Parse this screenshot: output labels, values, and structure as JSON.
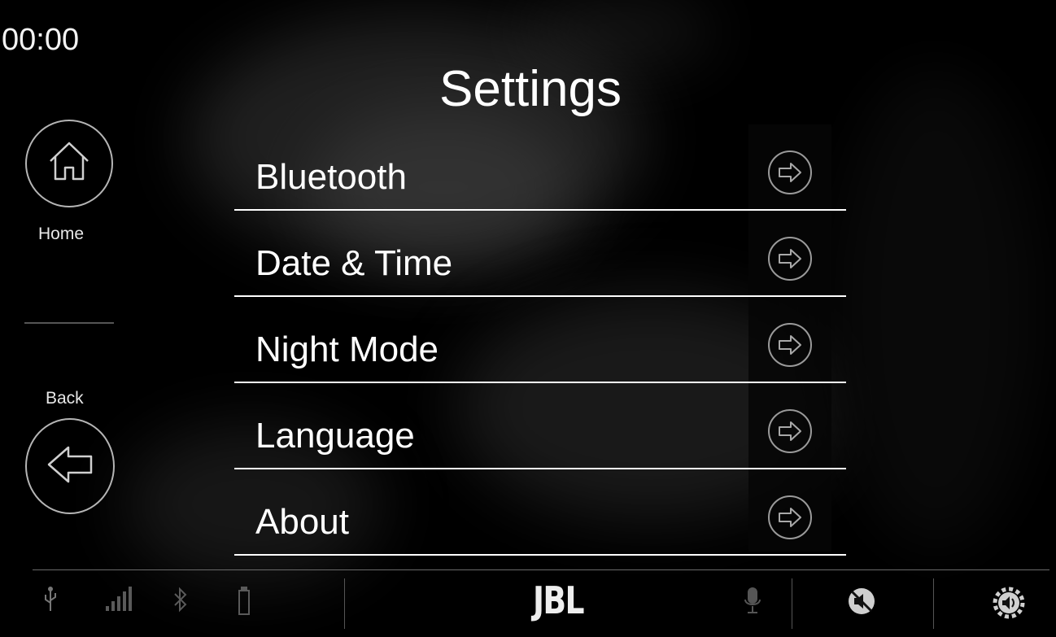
{
  "clock": {
    "time": "00:00"
  },
  "header": {
    "title": "Settings"
  },
  "sidebar": {
    "home": {
      "label": "Home",
      "icon": "home-icon"
    },
    "back": {
      "label": "Back",
      "icon": "arrow-left-icon"
    }
  },
  "menu": {
    "items": [
      {
        "label": "Bluetooth",
        "icon": "arrow-right-circle-icon"
      },
      {
        "label": "Date & Time",
        "icon": "arrow-right-circle-icon"
      },
      {
        "label": "Night Mode",
        "icon": "arrow-right-circle-icon"
      },
      {
        "label": "Language",
        "icon": "arrow-right-circle-icon"
      },
      {
        "label": "About",
        "icon": "arrow-right-circle-icon"
      }
    ]
  },
  "status_bar": {
    "icons": [
      "usb-icon",
      "signal-icon",
      "bluetooth-icon",
      "battery-icon",
      "microphone-icon",
      "mute-icon",
      "settings-icon"
    ],
    "brand": "JBL"
  },
  "colors": {
    "background": "#000000",
    "text": "#ffffff",
    "outline": "#b5b5b5"
  }
}
